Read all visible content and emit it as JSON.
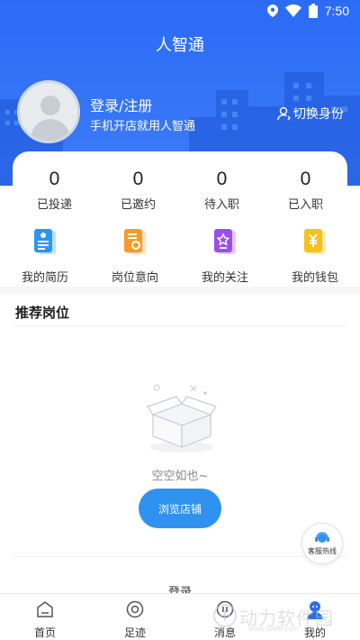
{
  "status_bar": {
    "time": "7:50"
  },
  "header": {
    "title": "人智通"
  },
  "profile": {
    "login_label": "登录/注册",
    "subtitle": "手机开店就用人智通",
    "switch_role": "切换身份"
  },
  "stats": [
    {
      "value": "0",
      "label": "已投递"
    },
    {
      "value": "0",
      "label": "已邀约"
    },
    {
      "value": "0",
      "label": "待入职"
    },
    {
      "value": "0",
      "label": "已入职"
    }
  ],
  "tools": [
    {
      "label": "我的简历",
      "icon": "resume-icon",
      "color": "#2b96ef"
    },
    {
      "label": "岗位意向",
      "icon": "job-intention-icon",
      "color": "#f79a2a"
    },
    {
      "label": "我的关注",
      "icon": "star-icon",
      "color": "#9b4ef0"
    },
    {
      "label": "我的钱包",
      "icon": "wallet-icon",
      "color": "#f4c21a"
    }
  ],
  "recommend": {
    "title": "推荐岗位",
    "empty_text": "空空如也~",
    "browse_button": "浏览店铺",
    "partial_text": "登录"
  },
  "customer_service": {
    "label": "客服热线"
  },
  "tabbar": [
    {
      "label": "首页",
      "icon": "home-icon"
    },
    {
      "label": "足迹",
      "icon": "footprint-icon"
    },
    {
      "label": "消息",
      "icon": "message-icon"
    },
    {
      "label": "我的",
      "icon": "profile-icon",
      "active": true
    }
  ],
  "watermark": {
    "text": "动力软件园",
    "url": "www.pw88.com"
  }
}
